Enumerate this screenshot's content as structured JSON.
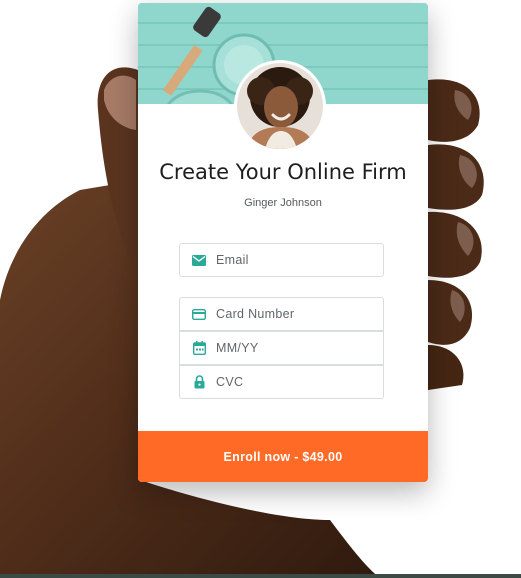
{
  "form": {
    "title": "Create Your Online Firm",
    "author": "Ginger Johnson",
    "fields": {
      "email": {
        "placeholder": "Email",
        "icon": "mail-icon"
      },
      "card_number": {
        "placeholder": "Card Number",
        "icon": "credit-card-icon"
      },
      "expiry": {
        "placeholder": "MM/YY",
        "icon": "calendar-icon"
      },
      "cvc": {
        "placeholder": "CVC",
        "icon": "lock-icon"
      }
    },
    "submit_label": "Enroll now - $49.00"
  },
  "colors": {
    "accent": "#ff6a26",
    "icon": "#2aa89a",
    "banner": "#8fd6cc"
  }
}
